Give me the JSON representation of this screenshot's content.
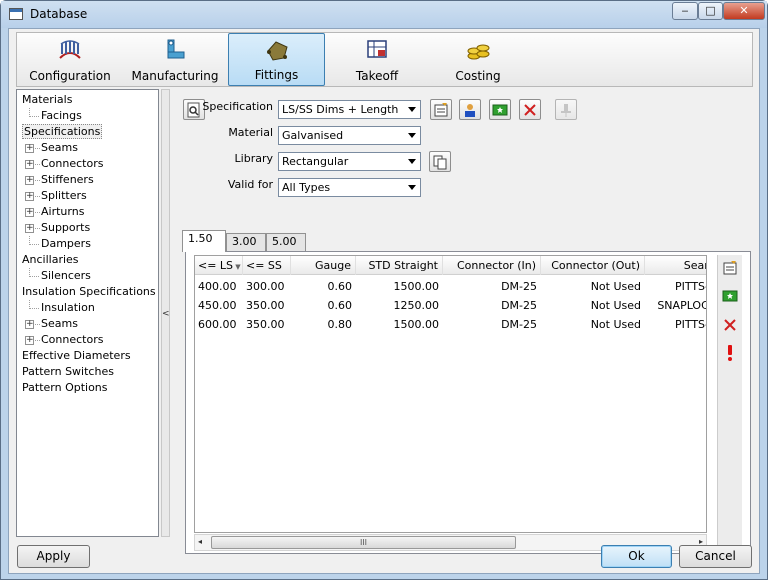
{
  "window": {
    "title": "Database",
    "min": "‒",
    "max": "□",
    "close": "✕"
  },
  "toptabs": [
    {
      "label": "Configuration",
      "icon": "ring-stack-icon"
    },
    {
      "label": "Manufacturing",
      "icon": "pipe-bend-icon"
    },
    {
      "label": "Fittings",
      "icon": "fitting-icon",
      "selected": true
    },
    {
      "label": "Takeoff",
      "icon": "takeoff-icon"
    },
    {
      "label": "Costing",
      "icon": "coins-icon"
    }
  ],
  "tree": {
    "nodes": [
      {
        "label": "Materials",
        "level": 0,
        "expander": false
      },
      {
        "label": "Facings",
        "level": 1,
        "expander": false
      },
      {
        "label": "Specifications",
        "level": 0,
        "expander": false,
        "selected": true
      },
      {
        "label": "Seams",
        "level": 1,
        "expander": true
      },
      {
        "label": "Connectors",
        "level": 1,
        "expander": true
      },
      {
        "label": "Stiffeners",
        "level": 1,
        "expander": true
      },
      {
        "label": "Splitters",
        "level": 1,
        "expander": true
      },
      {
        "label": "Airturns",
        "level": 1,
        "expander": true
      },
      {
        "label": "Supports",
        "level": 1,
        "expander": true
      },
      {
        "label": "Dampers",
        "level": 1,
        "expander": false
      },
      {
        "label": "Ancillaries",
        "level": 0,
        "expander": false
      },
      {
        "label": "Silencers",
        "level": 1,
        "expander": false
      },
      {
        "label": "Insulation Specifications",
        "level": 0,
        "expander": false
      },
      {
        "label": "Insulation",
        "level": 1,
        "expander": false
      },
      {
        "label": "Seams",
        "level": 1,
        "expander": true
      },
      {
        "label": "Connectors",
        "level": 1,
        "expander": true
      },
      {
        "label": "Effective Diameters",
        "level": 0,
        "expander": false
      },
      {
        "label": "Pattern Switches",
        "level": 0,
        "expander": false
      },
      {
        "label": "Pattern Options",
        "level": 0,
        "expander": false
      }
    ],
    "plus_glyph": "+",
    "collapse_glyph": "<"
  },
  "form": {
    "specification": {
      "label": "Specification",
      "value": "LS/SS Dims + Length"
    },
    "material": {
      "label": "Material",
      "value": "Galvanised"
    },
    "library": {
      "label": "Library",
      "value": "Rectangular"
    },
    "valid_for": {
      "label": "Valid for",
      "value": "All Types"
    }
  },
  "subtabs": [
    "1.50",
    "3.00",
    "5.00"
  ],
  "table": {
    "columns": [
      "<= LS",
      "<= SS",
      "Gauge",
      "STD Straight",
      "Connector (In)",
      "Connector (Out)",
      "Seam"
    ],
    "rows": [
      [
        "400.00",
        "300.00",
        "0.60",
        "1500.00",
        "DM-25",
        "Not Used",
        "PITTS-S"
      ],
      [
        "450.00",
        "350.00",
        "0.60",
        "1250.00",
        "DM-25",
        "Not Used",
        "SNAPLOCK"
      ],
      [
        "600.00",
        "350.00",
        "0.80",
        "1500.00",
        "DM-25",
        "Not Used",
        "PITTS-S"
      ]
    ],
    "scroll_grip": "III"
  },
  "buttons": {
    "apply": "Apply",
    "ok": "Ok",
    "cancel": "Cancel"
  }
}
